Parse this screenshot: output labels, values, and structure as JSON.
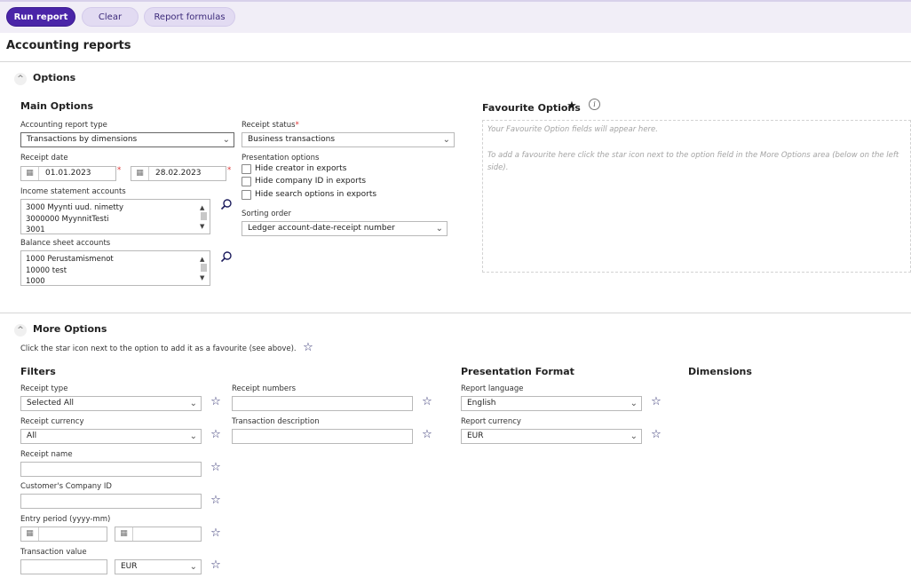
{
  "toolbar": {
    "run_report": "Run report",
    "clear": "Clear",
    "report_formulas": "Report formulas"
  },
  "page": {
    "title": "Accounting reports"
  },
  "options": {
    "section_title": "Options",
    "main_title": "Main Options",
    "report_type": {
      "label": "Accounting report type",
      "value": "Transactions by dimensions"
    },
    "receipt_status": {
      "label": "Receipt status",
      "value": "Business transactions"
    },
    "receipt_date": {
      "label": "Receipt date",
      "from": "01.01.2023",
      "to": "28.02.2023"
    },
    "presentation": {
      "label": "Presentation options",
      "items": [
        "Hide creator in exports",
        "Hide company ID in exports",
        "Hide search options in exports"
      ]
    },
    "income_accounts": {
      "label": "Income statement accounts",
      "items": [
        "3000 Myynti uud. nimetty",
        "3000000 MyynnitTesti",
        "3001"
      ]
    },
    "sorting": {
      "label": "Sorting order",
      "value": "Ledger account-date-receipt number"
    },
    "balance_accounts": {
      "label": "Balance sheet accounts",
      "items": [
        "1000 Perustamismenot",
        "10000 test",
        "1000"
      ]
    },
    "favourite": {
      "title": "Favourite Options",
      "hint1": "Your Favourite Option fields will appear here.",
      "hint2": "To add a favourite here click the star icon next to the option field in the More Options area (below on the left side)."
    }
  },
  "more": {
    "section_title": "More Options",
    "hint": "Click the star icon next to the option to add it as a favourite (see above).",
    "filters_title": "Filters",
    "presentation_title": "Presentation Format",
    "dimensions_title": "Dimensions",
    "receipt_type": {
      "label": "Receipt type",
      "value": "Selected All"
    },
    "receipt_numbers": {
      "label": "Receipt numbers",
      "value": ""
    },
    "receipt_currency": {
      "label": "Receipt currency",
      "value": "All"
    },
    "transaction_description": {
      "label": "Transaction description",
      "value": ""
    },
    "receipt_name": {
      "label": "Receipt name",
      "value": ""
    },
    "customer_company_id": {
      "label": "Customer's Company ID",
      "value": ""
    },
    "entry_period": {
      "label": "Entry period (yyyy-mm)",
      "from": "",
      "to": ""
    },
    "transaction_value": {
      "label": "Transaction value",
      "value": "",
      "currency": "EUR"
    },
    "report_language": {
      "label": "Report language",
      "value": "English"
    },
    "report_currency": {
      "label": "Report currency",
      "value": "EUR"
    }
  },
  "icons": {
    "star_outline": "☆",
    "star_filled": "★",
    "search": "⚲",
    "calendar": "▦",
    "chevron": "⌄",
    "collapse": "^"
  }
}
